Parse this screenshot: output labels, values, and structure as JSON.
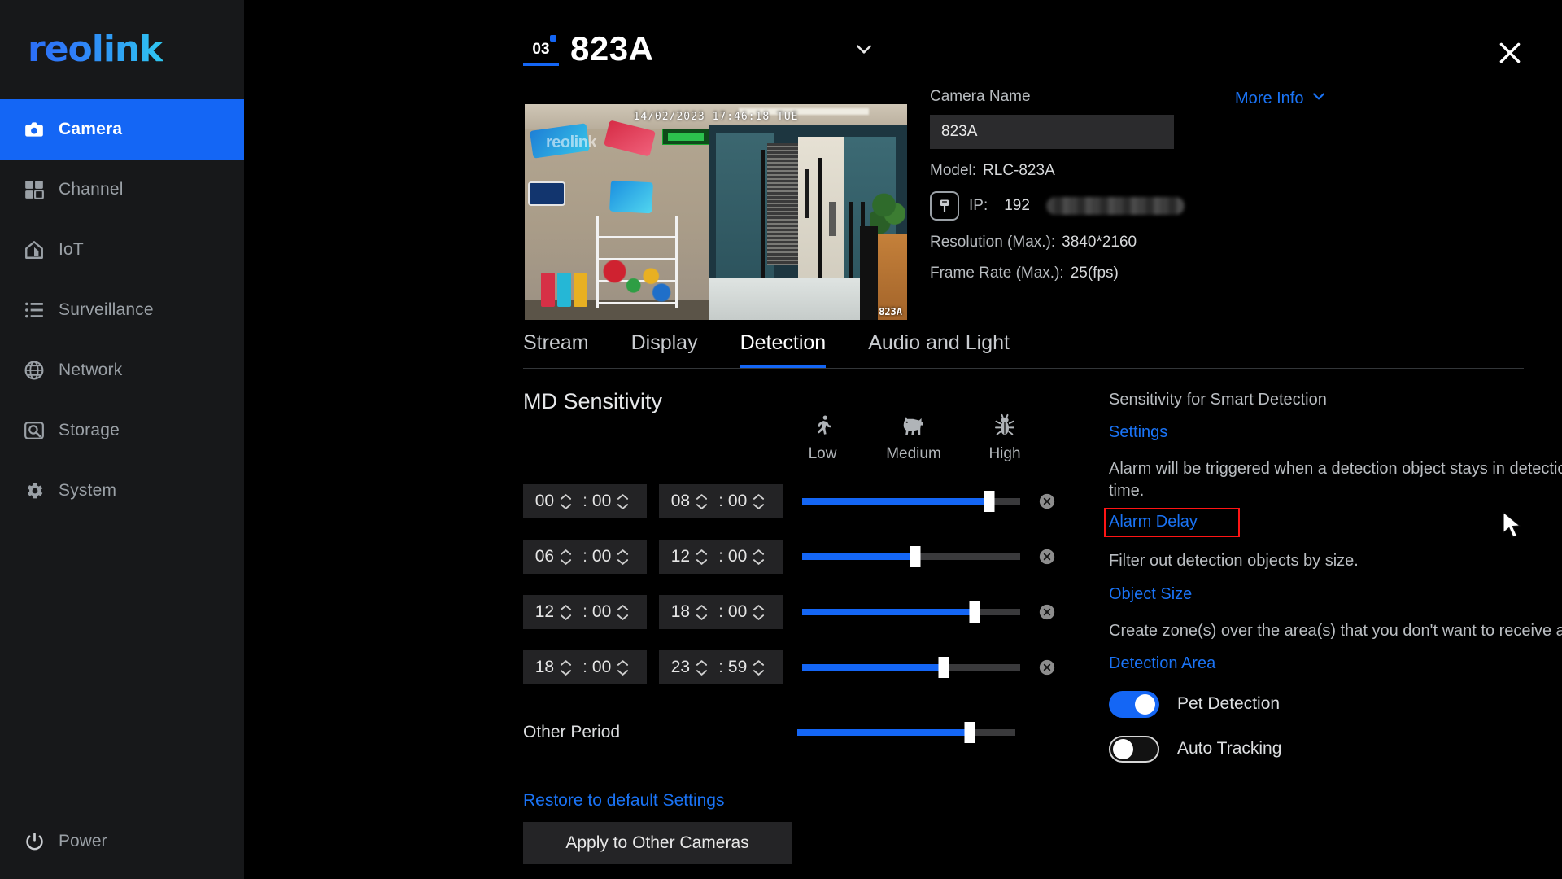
{
  "sidebar": {
    "logo": "reolink",
    "items": [
      {
        "label": "Camera",
        "icon": "camera-icon",
        "active": true
      },
      {
        "label": "Channel",
        "icon": "grid-icon",
        "active": false
      },
      {
        "label": "IoT",
        "icon": "home-icon",
        "active": false
      },
      {
        "label": "Surveillance",
        "icon": "list-icon",
        "active": false
      },
      {
        "label": "Network",
        "icon": "globe-icon",
        "active": false
      },
      {
        "label": "Storage",
        "icon": "disk-icon",
        "active": false
      },
      {
        "label": "System",
        "icon": "gear-icon",
        "active": false
      }
    ],
    "power_label": "Power"
  },
  "header": {
    "channel_number": "03",
    "camera_title": "823A",
    "dropdown_icon": "chevron-down-icon",
    "close_icon": "close-icon"
  },
  "preview": {
    "osd_timestamp": "14/02/2023 17:46:18 TUE",
    "osd_camera_name": "823A",
    "watermark": "reolink"
  },
  "info": {
    "camera_name_label": "Camera Name",
    "camera_name_value": "823A",
    "model_key": "Model:",
    "model_value": "RLC-823A",
    "ip_key": "IP:",
    "ip_value": "192",
    "ip_redacted": true,
    "resolution_key": "Resolution (Max.):",
    "resolution_value": "3840*2160",
    "framerate_key": "Frame Rate (Max.):",
    "framerate_value": "25(fps)",
    "more_info_label": "More Info"
  },
  "tabs": [
    {
      "label": "Stream",
      "active": false
    },
    {
      "label": "Display",
      "active": false
    },
    {
      "label": "Detection",
      "active": true
    },
    {
      "label": "Audio and Light",
      "active": false
    }
  ],
  "md_sensitivity": {
    "title": "MD Sensitivity",
    "scale_headers": [
      {
        "label": "Low",
        "icon": "running-person-icon"
      },
      {
        "label": "Medium",
        "icon": "dog-icon"
      },
      {
        "label": "High",
        "icon": "bug-icon"
      }
    ],
    "rows": [
      {
        "start_hour": "00",
        "start_min": "00",
        "end_hour": "08",
        "end_min": "00",
        "value_pct": 86,
        "clear_icon": "clear-circle-icon"
      },
      {
        "start_hour": "06",
        "start_min": "00",
        "end_hour": "12",
        "end_min": "00",
        "value_pct": 52,
        "clear_icon": "clear-circle-icon"
      },
      {
        "start_hour": "12",
        "start_min": "00",
        "end_hour": "18",
        "end_min": "00",
        "value_pct": 79,
        "clear_icon": "clear-circle-icon"
      },
      {
        "start_hour": "18",
        "start_min": "00",
        "end_hour": "23",
        "end_min": "59",
        "value_pct": 65,
        "clear_icon": "clear-circle-icon"
      }
    ],
    "other_period_label": "Other Period",
    "other_period_pct": 79,
    "restore_label": "Restore to default Settings",
    "apply_label": "Apply to Other Cameras"
  },
  "smart_detection": {
    "sensitivity_desc": "Sensitivity for Smart Detection",
    "settings_link": "Settings",
    "alarm_desc": "Alarm will be triggered when a detection object stays in detection zone longer than the set time.",
    "alarm_delay_link": "Alarm Delay",
    "alarm_delay_highlighted": true,
    "object_desc": "Filter out detection objects by size.",
    "object_size_link": "Object Size",
    "zone_desc": "Create zone(s) over the area(s) that you don't want to receive alerts about.",
    "detection_area_link": "Detection Area",
    "toggles": [
      {
        "label": "Pet Detection",
        "on": true
      },
      {
        "label": "Auto Tracking",
        "on": false
      }
    ]
  },
  "colors": {
    "accent_blue": "#1466f5",
    "link_blue": "#1a73f5",
    "highlight_red": "#ff1515",
    "sidebar_bg": "#17181a",
    "page_bg": "#000000"
  },
  "cursor": {
    "icon": "mouse-pointer-icon"
  }
}
